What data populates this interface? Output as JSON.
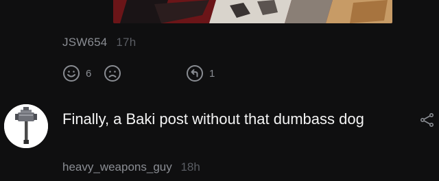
{
  "comment1": {
    "username": "JSW654",
    "timestamp": "17h",
    "like_count": "6",
    "reply_count": "1"
  },
  "comment2": {
    "text": "Finally, a Baki post without that dumbass dog",
    "username": "heavy_weapons_guy",
    "timestamp": "18h"
  },
  "icons": {
    "like": "smiley-face-icon",
    "dislike": "frown-face-icon",
    "reply": "reply-arrow-icon",
    "share": "share-arrow-icon"
  },
  "colors": {
    "background": "#0f0f10",
    "meta_text": "#8a8d93",
    "timestamp_text": "#5a5d63",
    "body_text": "#f4f4f4"
  }
}
